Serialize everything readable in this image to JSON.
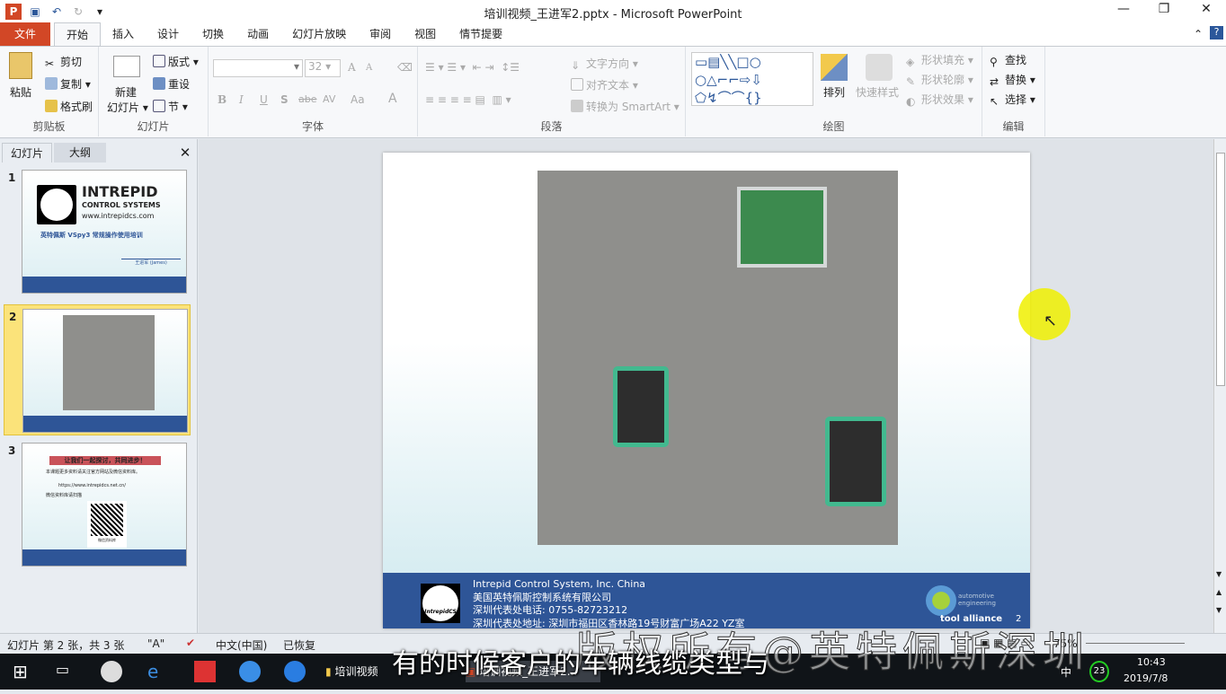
{
  "window": {
    "title": "培训视频_王进军2.pptx - Microsoft PowerPoint",
    "min": "—",
    "max": "❐",
    "close": "✕"
  },
  "tabs": [
    "文件",
    "开始",
    "插入",
    "设计",
    "切换",
    "动画",
    "幻灯片放映",
    "审阅",
    "视图",
    "情节提要"
  ],
  "ribbon": {
    "clipboard": {
      "paste": "粘贴",
      "cut": "剪切",
      "copy": "复制",
      "format_painter": "格式刷",
      "label": "剪贴板"
    },
    "slides": {
      "new_slide_1": "新建",
      "new_slide_2": "幻灯片",
      "layout": "版式",
      "reset": "重设",
      "section": "节",
      "label": "幻灯片"
    },
    "font": {
      "font_name": "",
      "font_size": "32",
      "label": "字体",
      "bold": "B",
      "italic": "I",
      "underline": "U",
      "shadow": "S",
      "strike": "abe",
      "spacing": "AV",
      "case": "Aa",
      "color": "A",
      "grow": "A",
      "shrink": "A"
    },
    "paragraph": {
      "text_direction": "文字方向",
      "align_text": "对齐文本",
      "smartart": "转换为 SmartArt",
      "label": "段落"
    },
    "drawing": {
      "arrange": "排列",
      "quick_styles": "快速样式",
      "shape_fill": "形状填充",
      "shape_outline": "形状轮廓",
      "shape_effects": "形状效果",
      "label": "绘图"
    },
    "editing": {
      "find": "查找",
      "replace": "替换",
      "select": "选择",
      "label": "编辑"
    }
  },
  "left_pane": {
    "tab_slides": "幻灯片",
    "tab_outline": "大纲",
    "close": "✕",
    "thumbs": [
      {
        "num": "1",
        "logo": "INTREPID",
        "sub": "CONTROL SYSTEMS",
        "url": "www.intrepidcs.com",
        "title": "英特佩斯 VSpy3 常规操作使用培训",
        "author": "王进军 (James)"
      },
      {
        "num": "2"
      },
      {
        "num": "3",
        "banner": "让我们一起探讨，共同进步！",
        "b1": "本课题更多资料请关注官方网站及微信资料库。",
        "link": "https://www.intrepidcs.net.cn/",
        "b2": "微信资料库请扫描",
        "qr": "微信资料库"
      }
    ]
  },
  "slide": {
    "footer": {
      "company_en": "Intrepid Control System, Inc. China",
      "company_cn": "美国英特佩斯控制系统有限公司",
      "phone": "深圳代表处电话: 0755-82723212",
      "address": "深圳代表处地址: 深圳市福田区香林路19号财富广场A22 YZ室",
      "alliance1": "automotive",
      "alliance2": "engineering",
      "alliance3": "tool alliance",
      "page": "2",
      "logo_text": "IntrepidCS"
    }
  },
  "status": {
    "slide_info": "幻灯片 第 2 张，共 3 张",
    "theme": "\"A\"",
    "language": "中文(中国)",
    "recovered": "已恢复",
    "zoom": "75%"
  },
  "taskbar": {
    "folder": "培训视频",
    "ppt": "培训视频_王进军2...",
    "time": "10:43",
    "date": "2019/7/8",
    "ime": "中",
    "badge": "23"
  },
  "overlay": {
    "subtitle": "有的时候客户的车辆线缆类型与",
    "watermark": "版权所有@英特佩斯深圳"
  }
}
